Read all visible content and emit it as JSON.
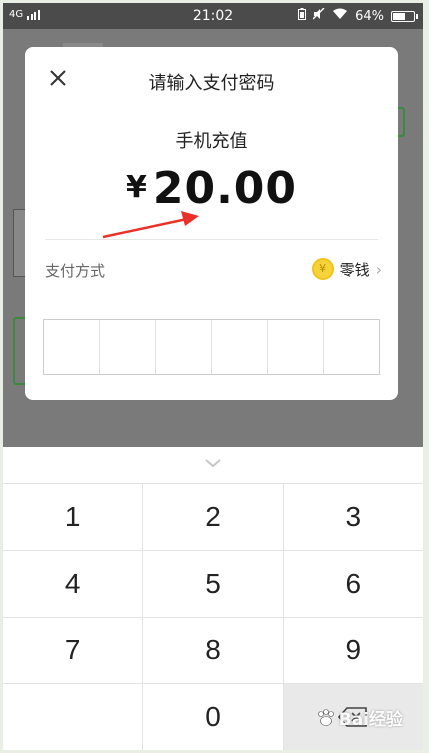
{
  "status_bar": {
    "network": "4G",
    "time": "21:02",
    "battery": "64%",
    "battery_level": 0.64
  },
  "dialog": {
    "title": "请输入支付密码",
    "product": "手机充值",
    "currency": "¥",
    "amount": "20.00",
    "payment_method_label": "支付方式",
    "payment_method_value": "零钱",
    "coin_symbol": "¥",
    "password_length": 6
  },
  "keypad": {
    "keys": [
      "1",
      "2",
      "3",
      "4",
      "5",
      "6",
      "7",
      "8",
      "9",
      "",
      "0",
      "backspace"
    ]
  },
  "watermark": "Bai经验",
  "colors": {
    "accent_green": "#3c8a3e",
    "coin": "#f6d33a",
    "arrow": "#e8322a"
  }
}
